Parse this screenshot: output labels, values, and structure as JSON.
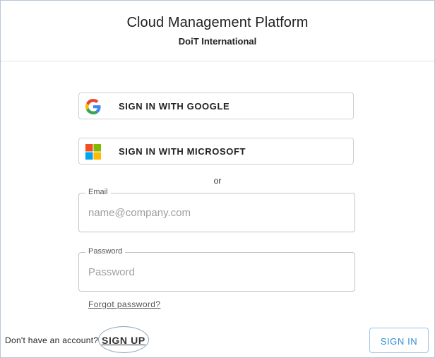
{
  "header": {
    "title": "Cloud Management Platform",
    "subtitle": "DoiT International"
  },
  "sso": {
    "google_label": "SIGN IN WITH GOOGLE",
    "google_icon": "google-icon",
    "microsoft_label": "SIGN IN WITH MICROSOFT",
    "microsoft_icon": "microsoft-icon"
  },
  "divider_text": "or",
  "email": {
    "label": "Email",
    "placeholder": "name@company.com",
    "value": ""
  },
  "password": {
    "label": "Password",
    "placeholder": "Password",
    "value": ""
  },
  "forgot_password_label": "Forgot password?",
  "footer": {
    "no_account_text": "Don't have an account?",
    "signup_label": "SIGN UP",
    "signin_label": "SIGN IN"
  },
  "colors": {
    "accent": "#2d8fd9",
    "border": "#c4c4c4"
  }
}
